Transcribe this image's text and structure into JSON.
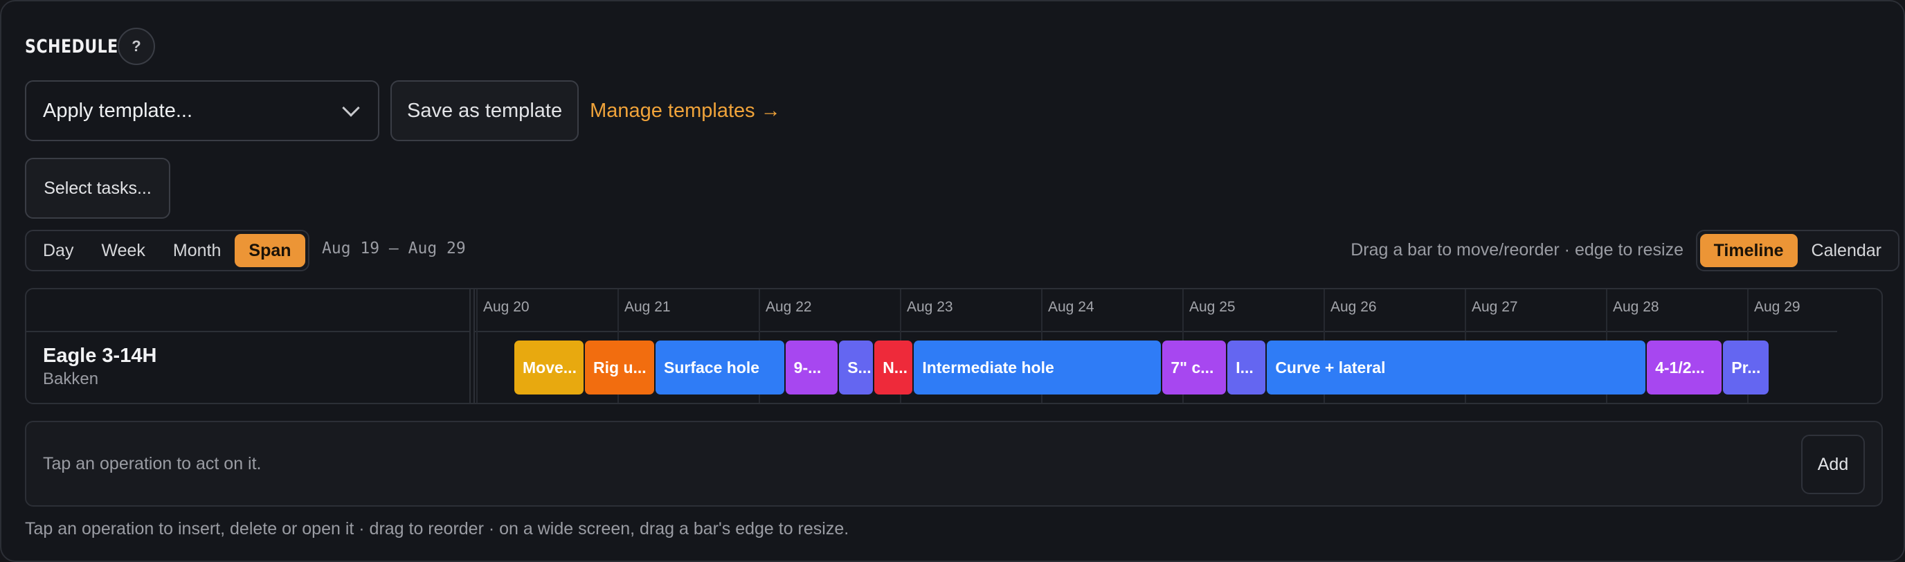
{
  "header": {
    "title": "SCHEDULE",
    "help_label": "?"
  },
  "templates": {
    "apply_placeholder": "Apply template...",
    "save_label": "Save as template",
    "manage_label": "Manage templates →"
  },
  "tasks": {
    "select_label": "Select tasks..."
  },
  "range": {
    "options": [
      "Day",
      "Week",
      "Month",
      "Span"
    ],
    "selected": "Span",
    "label": "Aug 19 – Aug 29"
  },
  "hint_top": "Drag a bar to move/reorder · edge to resize",
  "view": {
    "options": [
      "Timeline",
      "Calendar"
    ],
    "selected": "Timeline"
  },
  "timeline": {
    "days": [
      "Aug 20",
      "Aug 21",
      "Aug 22",
      "Aug 23",
      "Aug 24",
      "Aug 25",
      "Aug 26",
      "Aug 27",
      "Aug 28",
      "Aug 29"
    ],
    "row": {
      "name": "Eagle 3-14H",
      "sub": "Bakken"
    },
    "operations": [
      {
        "label": "Move...",
        "start_day": 0.25,
        "duration_days": 0.5,
        "color": "#e8a90f"
      },
      {
        "label": "Rig u...",
        "start_day": 0.75,
        "duration_days": 0.5,
        "color": "#f26d0f"
      },
      {
        "label": "Surface hole",
        "start_day": 1.25,
        "duration_days": 0.92,
        "color": "#2f7cf6"
      },
      {
        "label": "9-...",
        "start_day": 2.17,
        "duration_days": 0.38,
        "color": "#a747f0"
      },
      {
        "label": "S...",
        "start_day": 2.55,
        "duration_days": 0.25,
        "color": "#6466f1"
      },
      {
        "label": "N...",
        "start_day": 2.8,
        "duration_days": 0.28,
        "color": "#ee2a3a"
      },
      {
        "label": "Intermediate hole",
        "start_day": 3.08,
        "duration_days": 1.76,
        "color": "#2f7cf6"
      },
      {
        "label": "7\" c...",
        "start_day": 4.84,
        "duration_days": 0.46,
        "color": "#a747f0"
      },
      {
        "label": "I...",
        "start_day": 5.3,
        "duration_days": 0.28,
        "color": "#6466f1"
      },
      {
        "label": "Curve + lateral",
        "start_day": 5.58,
        "duration_days": 2.69,
        "color": "#2f7cf6"
      },
      {
        "label": "4-1/2...",
        "start_day": 8.27,
        "duration_days": 0.54,
        "color": "#a747f0"
      },
      {
        "label": "Pr...",
        "start_day": 8.81,
        "duration_days": 0.33,
        "color": "#6466f1"
      }
    ]
  },
  "action": {
    "text": "Tap an operation to act on it.",
    "add_label": "Add"
  },
  "footer_hint": "Tap an operation to insert, delete or open it · drag to reorder · on a wide screen, drag a bar's edge to resize."
}
